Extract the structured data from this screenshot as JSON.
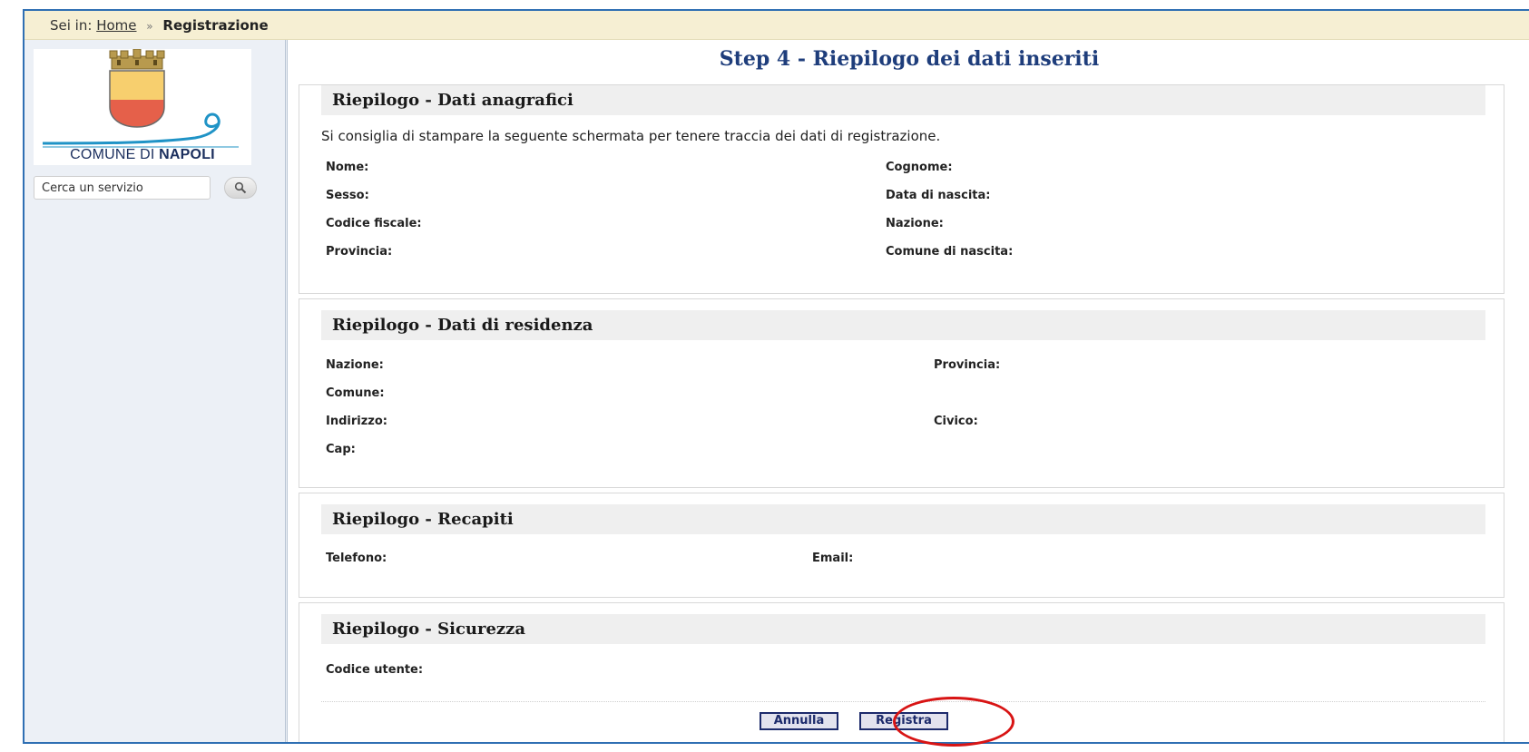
{
  "breadcrumb": {
    "prefix": "Sei in:",
    "home": "Home",
    "separator": "»",
    "current": "Registrazione"
  },
  "sidebar": {
    "logo_text_regular": "COMUNE DI ",
    "logo_text_bold": "NAPOLI",
    "search_placeholder": "Cerca un servizio"
  },
  "page_title": "Step 4 - Riepilogo dei dati inseriti",
  "sections": {
    "anagrafici": {
      "title": "Riepilogo - Dati anagrafici",
      "note": "Si consiglia di stampare la seguente schermata per tenere traccia dei dati di registrazione.",
      "fields": [
        "Nome:",
        "Cognome:",
        "Sesso:",
        "Data di nascita:",
        "Codice fiscale:",
        "Nazione:",
        "Provincia:",
        "Comune di nascita:"
      ]
    },
    "residenza": {
      "title": "Riepilogo - Dati di residenza",
      "fields": [
        "Nazione:",
        "Provincia:",
        "Comune:",
        "Indirizzo:",
        "Civico:",
        "Cap:"
      ]
    },
    "recapiti": {
      "title": "Riepilogo - Recapiti",
      "fields": [
        "Telefono:",
        "Email:"
      ]
    },
    "sicurezza": {
      "title": "Riepilogo - Sicurezza",
      "fields": [
        "Codice utente:"
      ]
    }
  },
  "buttons": {
    "cancel": "Annulla",
    "register": "Registra"
  },
  "colors": {
    "frame_border": "#2f6fb3",
    "breadcrumb_bg": "#f6efd3",
    "title": "#1e3d7b",
    "highlight": "#d81414"
  }
}
